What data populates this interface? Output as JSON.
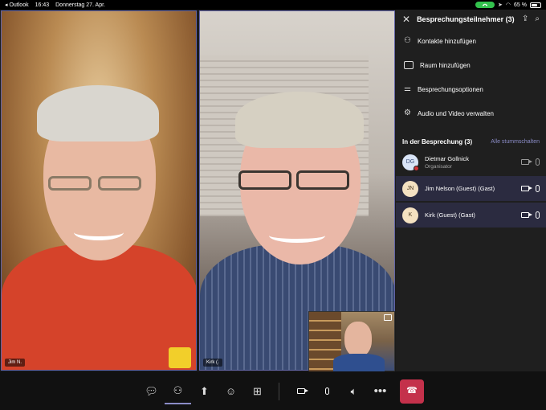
{
  "status_bar": {
    "back_app": "◂ Outlook",
    "time": "16:43",
    "date": "Donnerstag 27. Apr.",
    "battery": "65 %",
    "battery_level": 0.65
  },
  "videos": {
    "tile1_name": "Jim N.",
    "tile2_name": "Kirk (."
  },
  "panel": {
    "title": "Besprechungsteilnehmer (3)",
    "actions": [
      {
        "label": "Kontakte hinzufügen",
        "icon": "add-people-icon"
      },
      {
        "label": "Raum hinzufügen",
        "icon": "room-icon"
      },
      {
        "label": "Besprechungsoptionen",
        "icon": "sliders-icon"
      },
      {
        "label": "Audio und Video verwalten",
        "icon": "gear-icon"
      }
    ],
    "section_label": "In der Besprechung (3)",
    "mute_all": "Alle stummschalten",
    "participants": [
      {
        "initials": "DG",
        "name": "Dietmar Gollnick",
        "role": "Organisator"
      },
      {
        "initials": "JN",
        "name": "Jim Nelson (Guest) (Gast)",
        "role": ""
      },
      {
        "initials": "K",
        "name": "Kirk (Guest) (Gast)",
        "role": ""
      }
    ]
  },
  "controls": [
    "chat-icon",
    "people-icon",
    "share-icon",
    "reactions-icon",
    "apps-icon",
    "camera-icon",
    "mic-icon",
    "speaker-icon",
    "more-icon",
    "hangup-icon"
  ]
}
